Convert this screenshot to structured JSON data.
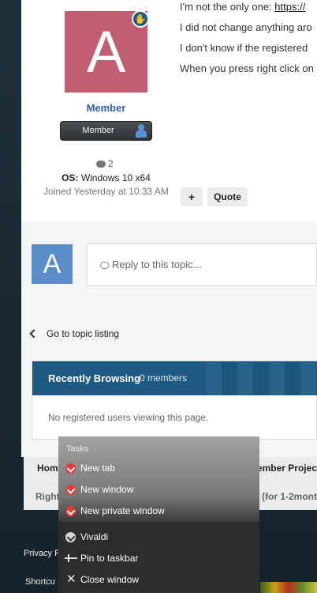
{
  "author": {
    "avatar_letter": "A",
    "badge_icon": "hand-icon",
    "group": "Member",
    "rank_title": "Member",
    "post_count": "2",
    "os_label": "OS:",
    "os_value": "Windows 10 x64",
    "joined": "Joined Yesterday at 10:33 AM"
  },
  "post": {
    "line1_prefix": "I'm not the only one: ",
    "line1_link": "https://",
    "line2": "I did not change anything aro",
    "line3": "I don't know if the registered",
    "line4": "When you press right click on"
  },
  "actions": {
    "plus": "+",
    "quote": "Quote"
  },
  "reply": {
    "avatar_letter": "A",
    "placeholder": "Reply to this topic..."
  },
  "nav": {
    "go_to_listing": "Go to topic listing"
  },
  "recently_browsing": {
    "title": "Recently Browsing",
    "count": "0 members",
    "empty": "No registered users viewing this page."
  },
  "footer": {
    "home": "Hom",
    "member_projects": "Member Projec",
    "rights": "Right",
    "months": "(for 1-2mont",
    "privacy": "Privacy P",
    "shortcut": "Shortcu"
  },
  "jumplist": {
    "section": "Tasks",
    "tasks": [
      {
        "label": "New tab",
        "icon": "vivaldi-icon"
      },
      {
        "label": "New window",
        "icon": "vivaldi-icon"
      },
      {
        "label": "New private window",
        "icon": "vivaldi-icon"
      }
    ],
    "app_name": "Vivaldi",
    "pin": "Pin to taskbar",
    "close": "Close window"
  }
}
